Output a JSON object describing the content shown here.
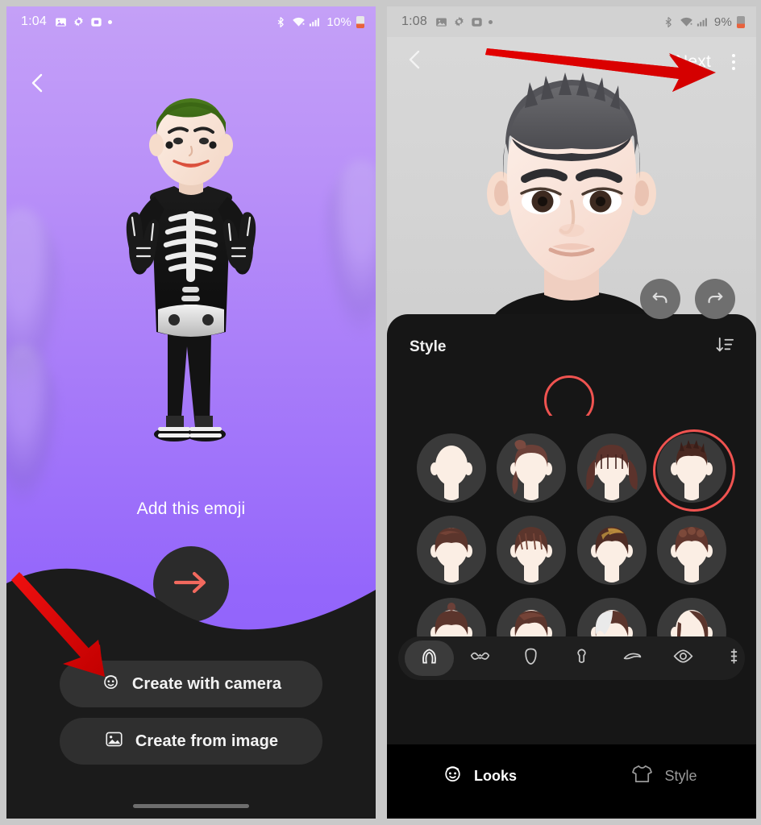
{
  "left_phone": {
    "status_bar": {
      "time": "1:04",
      "icons": [
        "photo-icon",
        "gear-icon",
        "screenshot-icon",
        "dot-indicator"
      ],
      "right_icons": [
        "bluetooth-icon",
        "wifi-icon",
        "signal-icon"
      ],
      "battery_percent": "10%"
    },
    "back_button": "back-chevron-icon",
    "avatar_caption": "Add this emoji",
    "next_fab_icon": "arrow-right-icon",
    "buttons": [
      {
        "label": "Create with camera",
        "icon": "face-camera-icon"
      },
      {
        "label": "Create from image",
        "icon": "picture-icon"
      }
    ],
    "home_indicator": true
  },
  "right_phone": {
    "status_bar": {
      "time": "1:08",
      "icons": [
        "photo-icon",
        "gear-icon",
        "screenshot-icon",
        "dot-indicator"
      ],
      "right_icons": [
        "bluetooth-icon",
        "wifi-icon",
        "signal-icon"
      ],
      "battery_percent": "9%"
    },
    "header": {
      "back_icon": "back-chevron-icon",
      "next_label": "Next",
      "overflow_icon": "kebab-menu-icon"
    },
    "editor_controls": {
      "undo_icon": "undo-icon",
      "redo_icon": "redo-icon"
    },
    "sheet": {
      "title": "Style",
      "sort_icon": "sort-icon",
      "color_swatches": [
        {
          "name": "dark-brown",
          "hex": "#6e523f",
          "selected": false
        },
        {
          "name": "white",
          "hex": "#fbfbfb",
          "selected": false
        },
        {
          "name": "light-grey",
          "hex": "#cfcfcf",
          "selected": false
        },
        {
          "name": "grey",
          "hex": "#6c6c6c",
          "selected": true
        },
        {
          "name": "blush",
          "hex": "#e3bdb0",
          "selected": false
        },
        {
          "name": "tan",
          "hex": "#c19480",
          "selected": false
        },
        {
          "name": "copper",
          "hex": "#b4745c",
          "selected": false
        },
        {
          "name": "bronze",
          "hex": "#c08464",
          "selected": false
        }
      ],
      "hairstyles": [
        {
          "name": "bald",
          "selected": false,
          "style": "bald"
        },
        {
          "name": "curly-updo",
          "selected": false,
          "style": "updo"
        },
        {
          "name": "pigtails",
          "selected": false,
          "style": "pigtails"
        },
        {
          "name": "short-spiky",
          "selected": true,
          "style": "spiky"
        },
        {
          "name": "short-messy-1",
          "selected": false,
          "style": "messy"
        },
        {
          "name": "short-fringe",
          "selected": false,
          "style": "fringe"
        },
        {
          "name": "highlighted-fringe",
          "selected": false,
          "style": "highlight"
        },
        {
          "name": "short-wavy",
          "selected": false,
          "style": "wavy"
        },
        {
          "name": "top-knot",
          "selected": false,
          "style": "topknot"
        },
        {
          "name": "side-part",
          "selected": false,
          "style": "sidepart"
        },
        {
          "name": "white-streak",
          "selected": false,
          "style": "streak"
        },
        {
          "name": "long-side",
          "selected": false,
          "style": "longside"
        }
      ],
      "categories": [
        {
          "name": "hair-icon",
          "active": true
        },
        {
          "name": "mustache-icon",
          "active": false
        },
        {
          "name": "face-shape-icon",
          "active": false
        },
        {
          "name": "nose-icon",
          "active": false
        },
        {
          "name": "eyebrow-icon",
          "active": false
        },
        {
          "name": "eye-icon",
          "active": false
        },
        {
          "name": "more-icon",
          "active": false
        }
      ]
    },
    "tabs": [
      {
        "label": "Looks",
        "icon": "face-icon",
        "active": true
      },
      {
        "label": "Style",
        "icon": "tshirt-icon",
        "active": false
      }
    ],
    "home_indicator": true
  },
  "annotations": {
    "arrow_color": "#e00000",
    "arrows": [
      {
        "name": "arrow-to-create-with-camera",
        "target": "Create with camera"
      },
      {
        "name": "arrow-to-next",
        "target": "Next"
      }
    ]
  },
  "theme": {
    "left_bg_top": "#c4a0f7",
    "left_bg_bottom": "#8a5cfc",
    "accent_red": "#ef5350",
    "fab_arrow": "#f2695e",
    "sheet_bg": "#161616",
    "page_bg": "#c9c9c9"
  }
}
